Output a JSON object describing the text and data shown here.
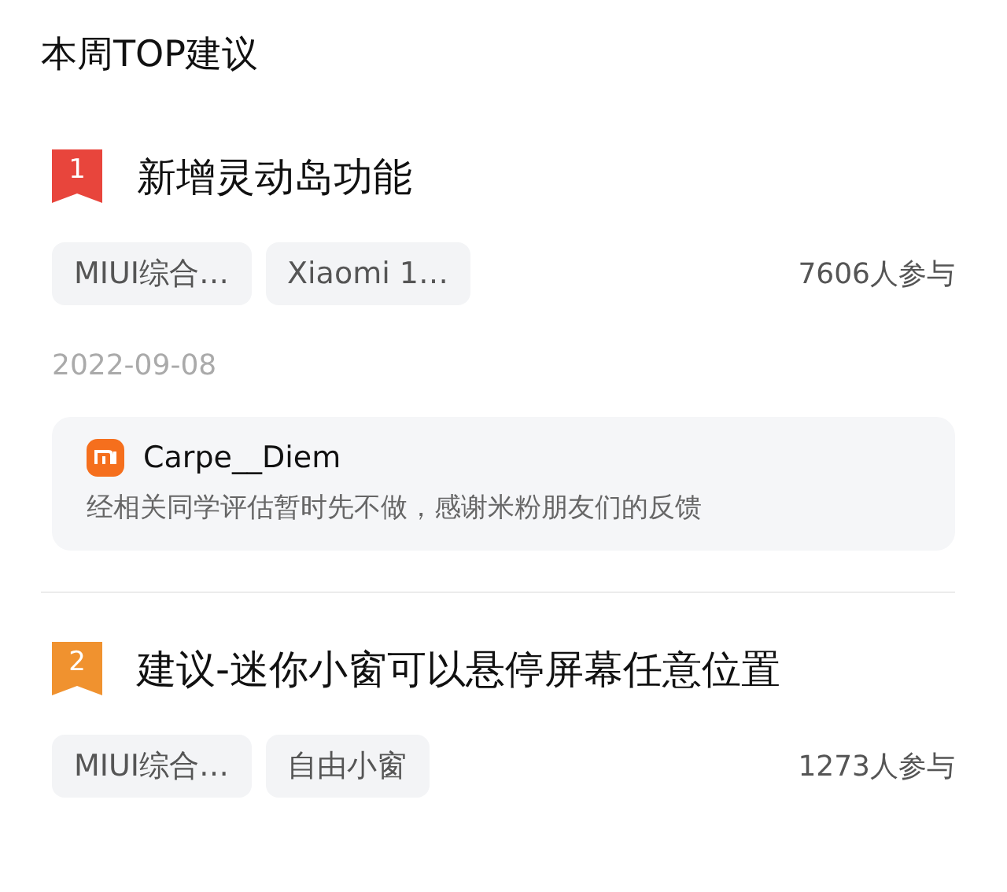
{
  "heading": "本周TOP建议",
  "suggestions": [
    {
      "rank": "1",
      "color": "#e8453c",
      "title": "新增灵动岛功能",
      "tags": [
        "MIUI综合…",
        "Xiaomi 1…"
      ],
      "participants": "7606人参与",
      "date": "2022-09-08",
      "reply": {
        "author": "Carpe__Diem",
        "text": "经相关同学评估暂时先不做，感谢米粉朋友们的反馈"
      }
    },
    {
      "rank": "2",
      "color": "#f0922f",
      "title": "建议-迷你小窗可以悬停屏幕任意位置",
      "tags": [
        "MIUI综合…",
        "自由小窗"
      ],
      "participants": "1273人参与"
    }
  ]
}
